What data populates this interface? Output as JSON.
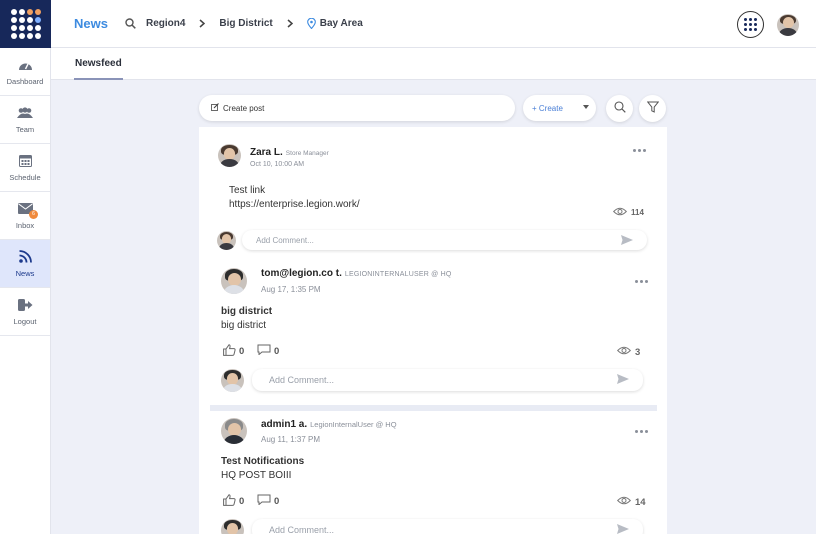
{
  "sidebar": {
    "items": [
      {
        "label": "Dashboard",
        "icon": "dashboard-icon"
      },
      {
        "label": "Team",
        "icon": "team-icon"
      },
      {
        "label": "Schedule",
        "icon": "calendar-icon"
      },
      {
        "label": "Inbox",
        "icon": "mail-icon",
        "badge": "6"
      },
      {
        "label": "News",
        "icon": "rss-icon",
        "active": true
      },
      {
        "label": "Logout",
        "icon": "logout-icon"
      }
    ]
  },
  "header": {
    "title": "News",
    "breadcrumb": [
      "Region4",
      "Big District",
      "Bay Area"
    ]
  },
  "tabs": [
    {
      "label": "Newsfeed",
      "active": true
    }
  ],
  "actions": {
    "create_post": "Create post",
    "create": "+ Create"
  },
  "posts": [
    {
      "author": "Zara L.",
      "role": "Store Manager",
      "time": "Oct 10, 10:00 AM",
      "lines": [
        "Test link",
        "https://enterprise.legion.work/"
      ],
      "views": "114",
      "comment_placeholder": "Add Comment..."
    },
    {
      "author": "tom@legion.co t.",
      "role": "LEGIONINTERNALUSER @ HQ",
      "time": "Aug 17, 1:35 PM",
      "lines": [
        "big district",
        "big district"
      ],
      "likes": "0",
      "comments": "0",
      "views": "3",
      "comment_placeholder": "Add Comment..."
    },
    {
      "author": "admin1 a.",
      "role": "LegionInternalUser @ HQ",
      "time": "Aug 11, 1:37 PM",
      "lines": [
        "Test Notifications",
        "HQ POST BOIII"
      ],
      "likes": "0",
      "comments": "0",
      "views": "14",
      "comment_placeholder": "Add Comment..."
    }
  ],
  "colors": {
    "brand_dark": "#17285a",
    "accent": "#3d8be0",
    "active_nav": "#dfe6fb",
    "badge": "#f08a3c"
  }
}
